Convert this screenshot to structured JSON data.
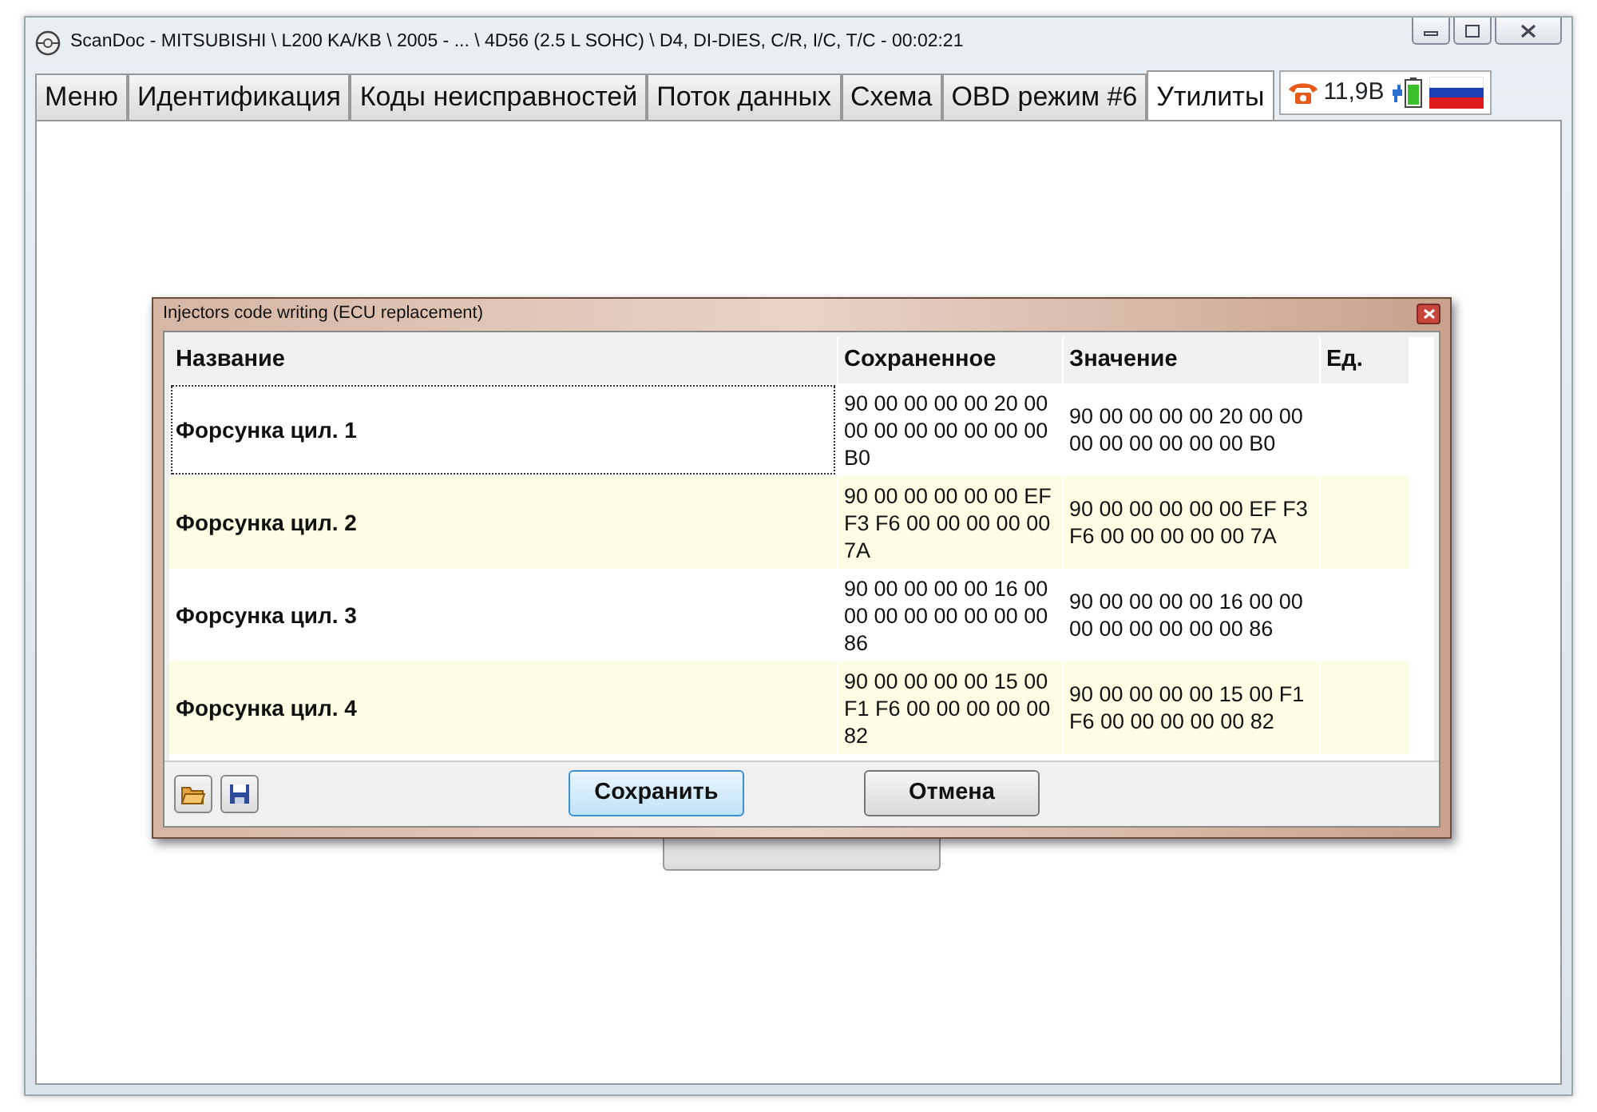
{
  "window": {
    "title": "ScanDoc - MITSUBISHI \\ L200 KA/KB \\ 2005 - ... \\ 4D56 (2.5 L SOHC) \\ D4, DI-DIES, C/R, I/C, T/C - 00:02:21"
  },
  "tabs": [
    {
      "label": "Меню",
      "selected": false
    },
    {
      "label": "Идентификация",
      "selected": false
    },
    {
      "label": "Коды неисправностей",
      "selected": false
    },
    {
      "label": "Поток данных",
      "selected": false
    },
    {
      "label": "Схема",
      "selected": false
    },
    {
      "label": "OBD режим #6",
      "selected": false
    },
    {
      "label": "Утилиты",
      "selected": true
    }
  ],
  "status": {
    "voltage": "11,9В"
  },
  "dialog": {
    "title": "Injectors code writing (ECU replacement)",
    "columns": [
      "Название",
      "Сохраненное",
      "Значение",
      "Ед."
    ],
    "rows": [
      {
        "name": "Форсунка цил. 1",
        "saved": "90 00 00 00 00 20 00 00 00 00 00 00 00 00 B0",
        "value": "90 00 00 00 00 20 00 00 00 00 00 00 00 00 B0",
        "selected": true
      },
      {
        "name": "Форсунка цил. 2",
        "saved": "90 00 00 00 00 00 EF F3 F6 00 00 00 00 00 7A",
        "value": "90 00 00 00 00 00 EF F3 F6 00 00 00 00 00 7A",
        "selected": false
      },
      {
        "name": "Форсунка цил. 3",
        "saved": "90 00 00 00 00 16 00 00 00 00 00 00 00 00 86",
        "value": "90 00 00 00 00 16 00 00 00 00 00 00 00 00 86",
        "selected": false
      },
      {
        "name": "Форсунка цил. 4",
        "saved": "90 00 00 00 00 15 00 F1 F6 00 00 00 00 00 82",
        "value": "90 00 00 00 00 15 00 F1 F6 00 00 00 00 00 82",
        "selected": false
      }
    ],
    "buttons": [
      "Сохранить",
      "Отмена"
    ]
  }
}
